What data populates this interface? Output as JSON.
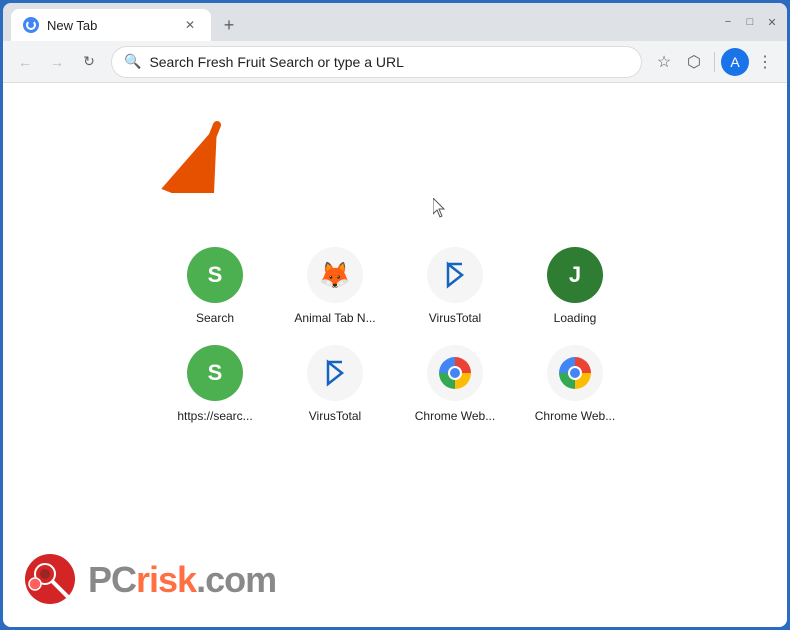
{
  "window": {
    "title": "New Tab",
    "minimize_label": "−",
    "maximize_label": "□",
    "close_label": "✕",
    "new_tab_label": "+"
  },
  "toolbar": {
    "back_label": "←",
    "forward_label": "→",
    "reload_label": "↻",
    "omnibox_text": "Search Fresh Fruit Search or type a URL",
    "bookmark_label": "☆",
    "extensions_label": "⬡",
    "menu_label": "⋮"
  },
  "shortcuts": [
    {
      "id": "search",
      "label": "Search",
      "letter": "S",
      "color": "#4caf50",
      "type": "letter"
    },
    {
      "id": "animal-tab",
      "label": "Animal Tab N...",
      "letter": "🦊",
      "color": "#f5f5f5",
      "type": "emoji"
    },
    {
      "id": "virustotal",
      "label": "VirusTotal",
      "letter": "VT",
      "color": "#f5f5f5",
      "type": "vt"
    },
    {
      "id": "loading",
      "label": "Loading",
      "letter": "J",
      "color": "#2e7d32",
      "type": "letter-dark"
    },
    {
      "id": "https-search",
      "label": "https://searc...",
      "letter": "S",
      "color": "#4caf50",
      "type": "letter"
    },
    {
      "id": "virustotal2",
      "label": "VirusTotal",
      "letter": "VT2",
      "color": "#f5f5f5",
      "type": "vt"
    },
    {
      "id": "chrome-web1",
      "label": "Chrome Web...",
      "letter": "CW",
      "color": "#f5f5f5",
      "type": "chrome"
    },
    {
      "id": "chrome-web2",
      "label": "Chrome Web...",
      "letter": "CW2",
      "color": "#f5f5f5",
      "type": "chrome"
    }
  ],
  "watermark": {
    "text_pc": "PC",
    "text_risk": "risk",
    "text_domain": ".com"
  }
}
